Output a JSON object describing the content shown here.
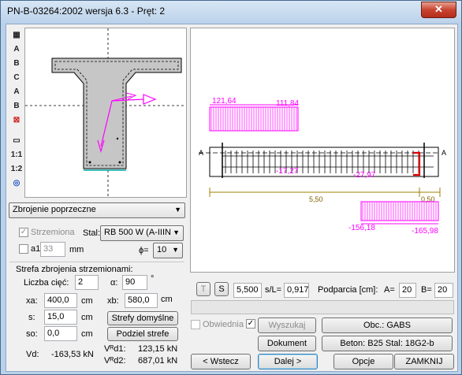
{
  "window": {
    "title": "PN-B-03264:2002 wersja 6.3 - Pręt: 2",
    "close_glyph": "✕"
  },
  "toolbar": {
    "tools": [
      {
        "name": "grid-tool-icon",
        "glyph": "▦"
      },
      {
        "name": "a-tool-icon",
        "glyph": "A"
      },
      {
        "name": "b-tool-icon",
        "glyph": "B"
      },
      {
        "name": "c-tool-icon",
        "glyph": "C"
      },
      {
        "name": "a2-tool-icon",
        "glyph": "A"
      },
      {
        "name": "b2-tool-icon",
        "glyph": "B"
      },
      {
        "name": "delete-tool-icon",
        "glyph": "⊠"
      },
      {
        "name": "ruler-tool-icon",
        "glyph": "▭"
      },
      {
        "name": "scale-1-1-icon",
        "glyph": "1:1"
      },
      {
        "name": "scale-1-2-icon",
        "glyph": "1:2"
      },
      {
        "name": "target-tool-icon",
        "glyph": "◎"
      }
    ]
  },
  "mode_select": {
    "value": "Zbrojenie poprzeczne"
  },
  "stirrup": {
    "checkbox_label": "Strzemiona",
    "steel_label": "Stal:",
    "steel_value": "RB 500 W (A-IIIN",
    "a1_label": "a1",
    "a1_value": "33",
    "a1_unit": "mm",
    "phi_label": "ϕ=",
    "phi_value": "10"
  },
  "zone": {
    "title": "Strefa zbrojenia strzemionami:",
    "cuts_label": "Liczba cięć:",
    "cuts_value": "2",
    "alpha_label": "α:",
    "alpha_value": "90",
    "alpha_unit": "°",
    "xa_label": "xa:",
    "xa_value": "400,0",
    "xa_unit": "cm",
    "xb_label": "xb:",
    "xb_value": "580,0",
    "xb_unit": "cm",
    "s_label": "s:",
    "s_value": "15,0",
    "s_unit": "cm",
    "so_label": "so:",
    "so_value": "0,0",
    "so_unit": "cm",
    "default_zones_btn": "Strefy domyślne",
    "split_zone_btn": "Podziel strefe"
  },
  "results": {
    "vd_label": "Vd:",
    "vd_value": "-163,53 kN",
    "vrd1_label": "Vᴿd1:",
    "vrd1_value": "123,15 kN",
    "vrd2_label": "Vᴿd2:",
    "vrd2_value": "687,01 kN"
  },
  "diagram": {
    "top_values": [
      "121,64",
      "111,84"
    ],
    "mid_values": [
      "-17,27",
      "-27,97"
    ],
    "bottom_values": [
      "-156,18",
      "-165,98"
    ],
    "dims": [
      "5,50",
      "0,50"
    ],
    "section_labels": [
      "A",
      "A"
    ]
  },
  "controls": {
    "t_btn": "T",
    "s_btn": "S",
    "pos_value": "5,500",
    "sl_label": "s/L=",
    "sl_value": "0,917",
    "support_label": "Podparcia [cm]:",
    "a_label": "A=",
    "a_value": "20",
    "b_label": "B=",
    "b_value": "20"
  },
  "actions": {
    "envelope_label": "Obwiednia",
    "search_btn": "Wyszukaj",
    "load_btn": "Obc.: GABS",
    "document_btn": "Dokument",
    "materials_btn": "Beton: B25  Stal: 18G2-b",
    "back_btn": "< Wstecz",
    "next_btn": "Dalej >",
    "options_btn": "Opcje",
    "close_btn": "ZAMKNIJ"
  }
}
